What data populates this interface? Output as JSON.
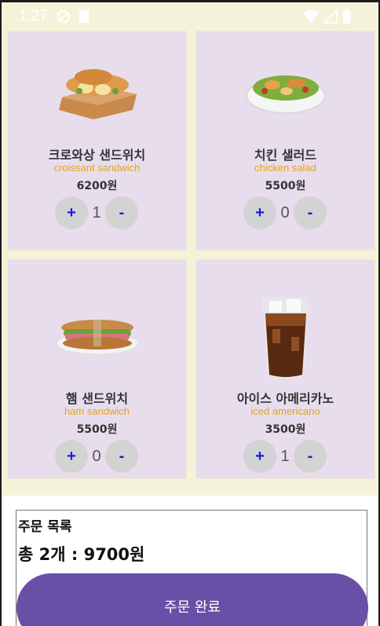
{
  "status_bar": {
    "time": "1:27",
    "left_icons": [
      "do-not-disturb-icon",
      "sd-card-icon"
    ],
    "right_icons": [
      "wifi-icon",
      "signal-icon",
      "battery-icon"
    ]
  },
  "menu": {
    "items": [
      {
        "name_ko": "크로와상 샌드위치",
        "name_en": "croissant sandwich",
        "price": "6200원",
        "quantity": "1",
        "plus_label": "+",
        "minus_label": "-",
        "image": "croissant-sandwich-image"
      },
      {
        "name_ko": "치킨 샐러드",
        "name_en": "chicken salad",
        "price": "5500원",
        "quantity": "0",
        "plus_label": "+",
        "minus_label": "-",
        "image": "chicken-salad-image"
      },
      {
        "name_ko": "햄 샌드위치",
        "name_en": "ham sandwich",
        "price": "5500원",
        "quantity": "0",
        "plus_label": "+",
        "minus_label": "-",
        "image": "ham-sandwich-image"
      },
      {
        "name_ko": "아이스 아메리카노",
        "name_en": "iced americano",
        "price": "3500원",
        "quantity": "1",
        "plus_label": "+",
        "minus_label": "-",
        "image": "iced-americano-image"
      }
    ]
  },
  "order": {
    "title": "주문 목록",
    "total": "총 2개 : 9700원",
    "complete_label": "주문 완료"
  },
  "colors": {
    "background_cream": "#f4f3da",
    "card_bg": "#e7ddec",
    "accent_orange": "#e4a321",
    "button_purple": "#6a4fa6",
    "stepper_blue": "#1a1ae6"
  }
}
